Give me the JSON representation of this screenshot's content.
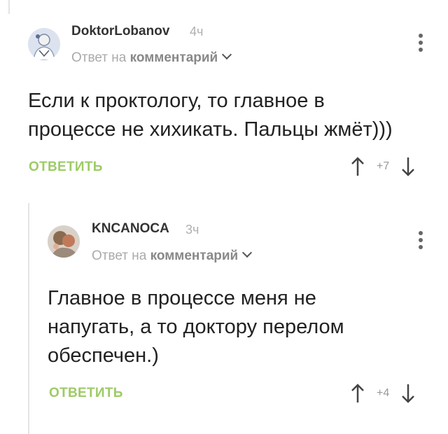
{
  "comments": [
    {
      "username": "DoktorLobanov",
      "time": "4ч",
      "reply_prefix": "Ответ на",
      "reply_target": "комментарий",
      "text_lines": [
        "Если к проктологу, то главное в",
        "процессе не хихикать. Пальцы жмёт)))"
      ],
      "reply_label": "ОТВЕТИТЬ",
      "score": "+7"
    },
    {
      "username": "KNCANOCA",
      "time": "3ч",
      "reply_prefix": "Ответ на",
      "reply_target": "комментарий",
      "text_lines": [
        "Главное в процессе меня не",
        "напугать, а то доктору перелом",
        "обеспечен.)"
      ],
      "reply_label": "ОТВЕТИТЬ",
      "score": "+4"
    }
  ],
  "colors": {
    "accent": "#9dcb66",
    "muted": "#aaaaaa"
  },
  "icons": [
    "avatar",
    "chevron-down-icon",
    "more-vertical-icon",
    "upvote-icon",
    "downvote-icon"
  ]
}
